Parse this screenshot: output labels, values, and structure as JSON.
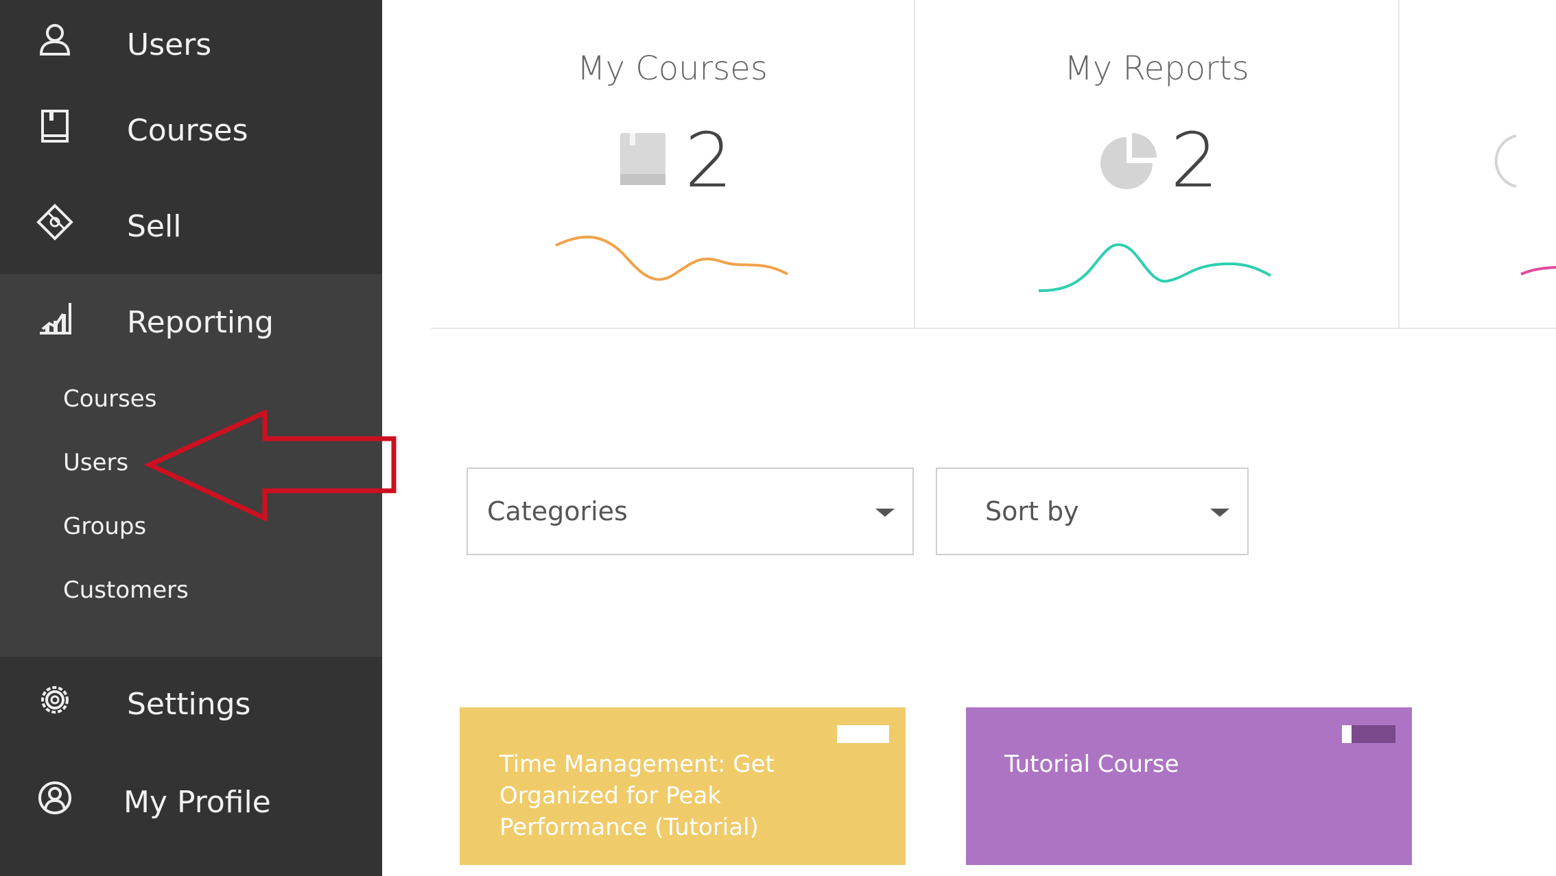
{
  "sidebar": {
    "items": [
      {
        "label": "Users",
        "icon": "user-icon"
      },
      {
        "label": "Courses",
        "icon": "book-icon"
      },
      {
        "label": "Sell",
        "icon": "ticket-icon"
      },
      {
        "label": "Reporting",
        "icon": "chart-icon"
      },
      {
        "label": "Settings",
        "icon": "gear-icon"
      },
      {
        "label": "My Profile",
        "icon": "profile-icon"
      }
    ],
    "reporting_sub": [
      "Courses",
      "Users",
      "Groups",
      "Customers"
    ]
  },
  "stats": [
    {
      "title": "My Courses",
      "value": "2",
      "icon": "book-icon",
      "color": "#f0a24a"
    },
    {
      "title": "My Reports",
      "value": "2",
      "icon": "pie-chart-icon",
      "color": "#2ecfb0"
    }
  ],
  "filters": {
    "categories": "Categories",
    "sort_by": "Sort by"
  },
  "courses": [
    {
      "title": "Time Management: Get Organized for Peak Performance (Tutorial)",
      "color": "#f0cb6a"
    },
    {
      "title": "Tutorial Course",
      "color": "#ad74c3"
    }
  ],
  "colors": {
    "sidebar": "#333333",
    "sidebar_active": "#3f3f3f",
    "annotation_arrow": "#cc1020",
    "third_sparkline": "#e24aa0"
  }
}
